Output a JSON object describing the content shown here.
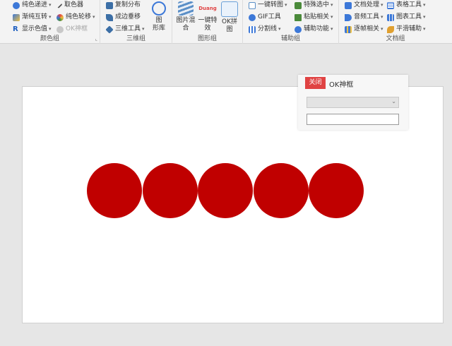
{
  "ribbon": {
    "groups": [
      {
        "label": "颜色组",
        "items": [
          {
            "label": "纯色递进",
            "icon": "color-palette-icon",
            "color": "#3c78d8"
          },
          {
            "label": "取色器",
            "icon": "eyedropper-icon",
            "color": "#555555"
          },
          {
            "label": "渐纯互转",
            "icon": "gradient-swap-icon",
            "color": "#3c78d8"
          },
          {
            "label": "纯色轮移",
            "icon": "color-wheel-icon",
            "color": "#3c78d8"
          },
          {
            "label": "显示色值",
            "icon": "rgb-r-icon",
            "color": "#1f5fbf"
          },
          {
            "label": "OK神框",
            "icon": "ok-frame-icon",
            "color": "#aaaaaa"
          }
        ]
      },
      {
        "label": "三维组",
        "items": [
          {
            "label": "复制分布",
            "icon": "copy-distribute-icon",
            "color": "#3c6fa6"
          },
          {
            "label": "成边垂移",
            "icon": "edge-move-icon",
            "color": "#3c6fa6"
          },
          {
            "label": "三维工具",
            "icon": "cube-icon",
            "color": "#3c6fa6"
          },
          {
            "label": "图\n形库",
            "icon": "shape-library-icon",
            "color": "#3c78d8"
          }
        ]
      },
      {
        "label": "图形组",
        "items": [
          {
            "label": "图片混\n合",
            "icon": "image-blend-icon",
            "color": "#5b8fc7"
          },
          {
            "label": "一键特\n效",
            "icon": "duang-effect-icon",
            "color": "#e04343",
            "icon_text": "Duang"
          },
          {
            "label": "OK拼\n图",
            "icon": "puzzle-image-icon",
            "color": "#6aa0d8"
          }
        ]
      },
      {
        "label": "辅助组",
        "items": [
          {
            "label": "一键转图",
            "icon": "convert-image-icon",
            "color": "#5b8fc7"
          },
          {
            "label": "特殊选中",
            "icon": "special-select-icon",
            "color": "#4a8a3a"
          },
          {
            "label": "GIF工具",
            "icon": "gif-icon",
            "color": "#3c78d8"
          },
          {
            "label": "粘贴相关",
            "icon": "paste-icon",
            "color": "#4a8a3a"
          },
          {
            "label": "分割线",
            "icon": "grid-lines-icon",
            "color": "#3c78d8"
          },
          {
            "label": "辅助功能",
            "icon": "assist-icon",
            "color": "#3c78d8"
          }
        ]
      },
      {
        "label": "文档组",
        "items": [
          {
            "label": "文档处理",
            "icon": "document-icon",
            "color": "#3c78d8"
          },
          {
            "label": "表格工具",
            "icon": "table-icon",
            "color": "#3c78d8"
          },
          {
            "label": "音频工具",
            "icon": "audio-icon",
            "color": "#3c78d8"
          },
          {
            "label": "图表工具",
            "icon": "chart-icon",
            "color": "#3c78d8"
          },
          {
            "label": "逐帧相关",
            "icon": "frame-icon",
            "color": "#3c78d8"
          },
          {
            "label": "平滑辅助",
            "icon": "smooth-icon",
            "color": "#e0a030"
          }
        ]
      }
    ]
  },
  "slide": {
    "shape_color": "#c00000",
    "circles": 5
  },
  "ok_panel": {
    "close_label": "关闭",
    "title": "OK神框",
    "select_value": "",
    "input_value": "",
    "close_color": "#e04343"
  }
}
